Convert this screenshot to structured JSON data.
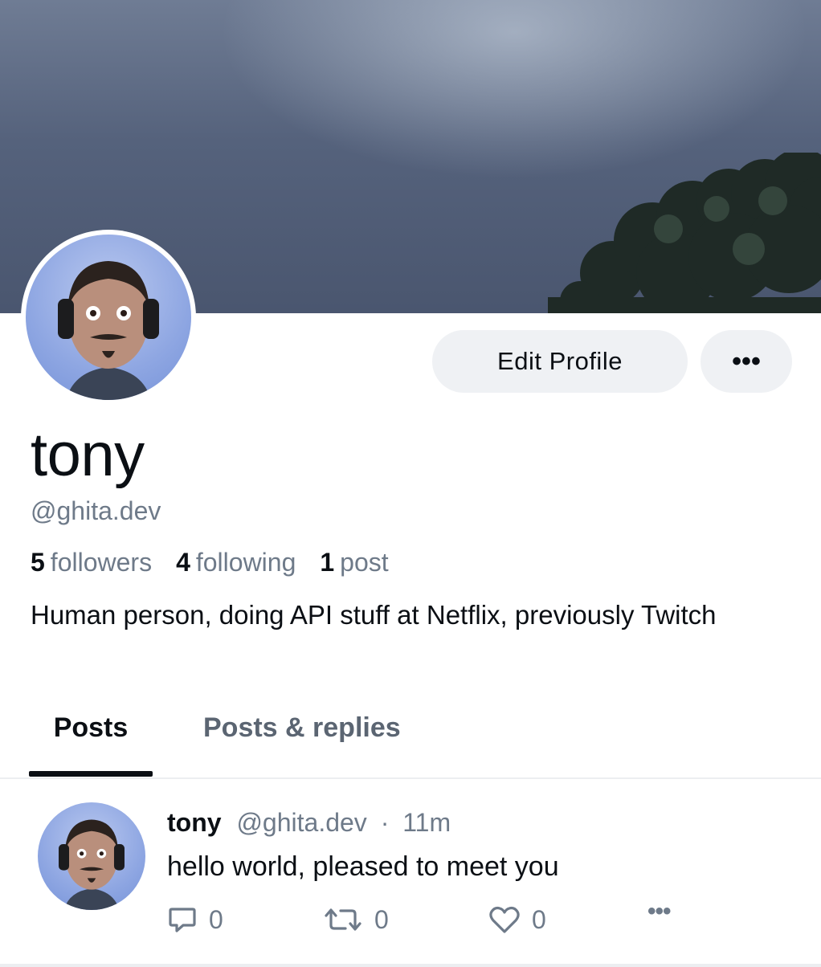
{
  "profile": {
    "display_name": "tony",
    "handle": "@ghita.dev",
    "bio": "Human person, doing API stuff at Netflix, previously Twitch",
    "stats": {
      "followers_count": "5",
      "followers_label": "followers",
      "following_count": "4",
      "following_label": "following",
      "posts_count": "1",
      "posts_label": "post"
    }
  },
  "actions": {
    "edit_profile_label": "Edit Profile",
    "more_label": "•••"
  },
  "tabs": [
    {
      "label": "Posts",
      "active": true
    },
    {
      "label": "Posts & replies",
      "active": false
    }
  ],
  "post": {
    "author": "tony",
    "handle": "@ghita.dev",
    "separator": "·",
    "time": "11m",
    "text": "hello world, pleased to meet you",
    "reply_count": "0",
    "repost_count": "0",
    "like_count": "0",
    "more_label": "•••"
  },
  "icons": [
    "tree-icon",
    "reply-icon",
    "repost-icon",
    "heart-icon",
    "more-icon"
  ],
  "colors": {
    "text_primary": "#0b0f14",
    "text_secondary": "#6e7a89",
    "button_bg": "#eff1f4",
    "banner_sky": "#55627c",
    "avatar_bg": "#8ea6e2"
  }
}
